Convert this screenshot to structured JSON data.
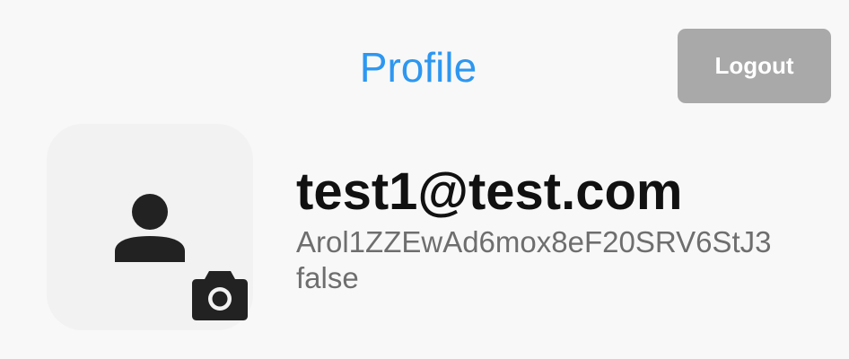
{
  "header": {
    "title": "Profile",
    "logout_label": "Logout"
  },
  "profile": {
    "avatar_icon": "person-icon",
    "camera_icon": "camera-icon",
    "email": "test1@test.com",
    "uid": "Arol1ZZEwAd6mox8eF20SRV6StJ3",
    "email_verified": "false"
  },
  "colors": {
    "title": "#2d97f0",
    "logout_bg": "#a9a9a9",
    "background": "#f8f8f8",
    "avatar_bg": "#f2f2f2",
    "icon": "#222222"
  }
}
